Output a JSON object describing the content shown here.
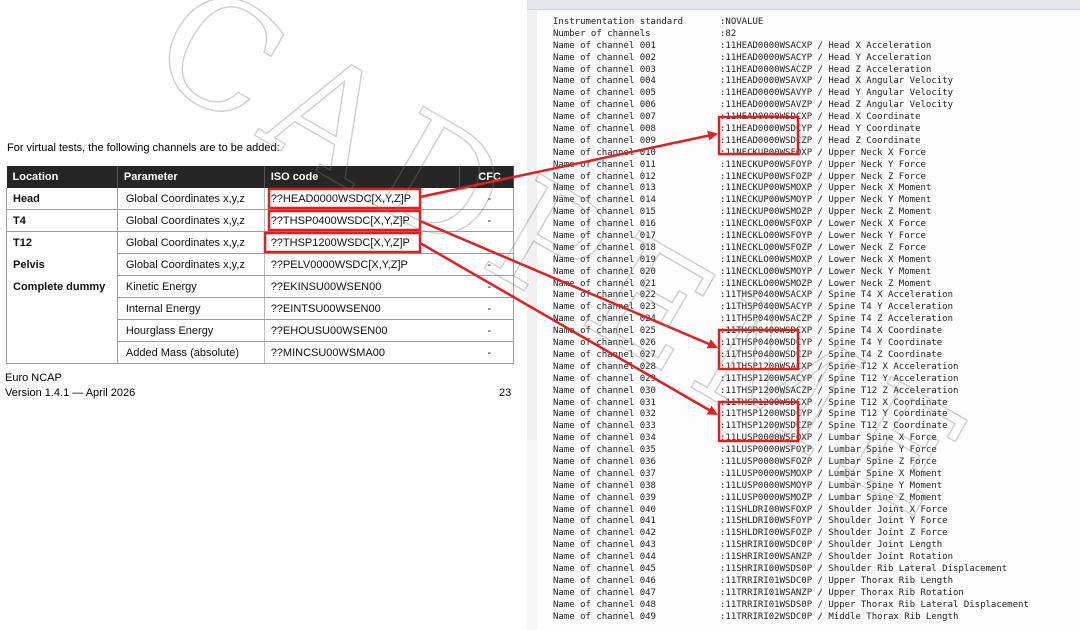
{
  "document": {
    "intro": "For virtual tests, the following channels are to be added:",
    "table": {
      "headers": [
        "Location",
        "Parameter",
        "ISO code",
        "CFC"
      ],
      "rows": [
        {
          "location": "Head",
          "parameter": "Global Coordinates x,y,z",
          "iso": "??HEAD0000WSDC[X,Y,Z]P",
          "cfc": "-"
        },
        {
          "location": "T4",
          "parameter": "Global Coordinates x,y,z",
          "iso": "??THSP0400WSDC[X,Y,Z]P",
          "cfc": "-"
        },
        {
          "location": "T12",
          "parameter": "Global Coordinates x,y,z",
          "iso": "??THSP1200WSDC[X,Y,Z]P",
          "cfc": ""
        },
        {
          "location": "Pelvis",
          "parameter": "Global Coordinates x,y,z",
          "iso": "??PELV0000WSDC[X,Y,Z]P",
          "cfc": "-"
        },
        {
          "location": "Complete dummy",
          "parameter": "Kinetic Energy",
          "iso": "??EKINSU00WSEN00",
          "cfc": "-"
        },
        {
          "location": "",
          "parameter": "Internal Energy",
          "iso": "??EINTSU00WSEN00",
          "cfc": "-"
        },
        {
          "location": "",
          "parameter": "Hourglass Energy",
          "iso": "??EHOUSU00WSEN00",
          "cfc": "-"
        },
        {
          "location": "",
          "parameter": "Added Mass (absolute)",
          "iso": "??MINCSU00WSMA00",
          "cfc": "-"
        }
      ]
    },
    "footer_org": "Euro NCAP",
    "footer_version": "Version 1.4.1 — April 2026",
    "page_number": "23"
  },
  "code_panel": {
    "lines": [
      {
        "label": "Instrumentation standard",
        "value": ":NOVALUE"
      },
      {
        "label": "Number of channels",
        "value": ":82"
      },
      {
        "label": "Name of channel 001",
        "value": ":11HEAD0000WSACXP / Head X Acceleration"
      },
      {
        "label": "Name of channel 002",
        "value": ":11HEAD0000WSACYP / Head Y Acceleration"
      },
      {
        "label": "Name of channel 003",
        "value": ":11HEAD0000WSACZP / Head Z Acceleration"
      },
      {
        "label": "Name of channel 004",
        "value": ":11HEAD0000WSAVXP / Head X Angular Velocity"
      },
      {
        "label": "Name of channel 005",
        "value": ":11HEAD0000WSAVYP / Head Y Angular Velocity"
      },
      {
        "label": "Name of channel 006",
        "value": ":11HEAD0000WSAVZP / Head Z Angular Velocity"
      },
      {
        "label": "Name of channel 007",
        "value": ":11HEAD0000WSDCXP / Head X Coordinate"
      },
      {
        "label": "Name of channel 008",
        "value": ":11HEAD0000WSDCYP / Head Y Coordinate"
      },
      {
        "label": "Name of channel 009",
        "value": ":11HEAD0000WSDCZP / Head Z Coordinate"
      },
      {
        "label": "Name of channel 010",
        "value": ":11NECKUP00WSFOXP / Upper Neck X Force"
      },
      {
        "label": "Name of channel 011",
        "value": ":11NECKUP00WSFOYP / Upper Neck Y Force"
      },
      {
        "label": "Name of channel 012",
        "value": ":11NECKUP00WSFOZP / Upper Neck Z Force"
      },
      {
        "label": "Name of channel 013",
        "value": ":11NECKUP00WSMOXP / Upper Neck X Moment"
      },
      {
        "label": "Name of channel 014",
        "value": ":11NECKUP00WSMOYP / Upper Neck Y Moment"
      },
      {
        "label": "Name of channel 015",
        "value": ":11NECKUP00WSMOZP / Upper Neck Z Moment"
      },
      {
        "label": "Name of channel 016",
        "value": ":11NECKLO00WSFOXP / Lower Neck X Force"
      },
      {
        "label": "Name of channel 017",
        "value": ":11NECKLO00WSFOYP / Lower Neck Y Force"
      },
      {
        "label": "Name of channel 018",
        "value": ":11NECKLO00WSFOZP / Lower Neck Z Force"
      },
      {
        "label": "Name of channel 019",
        "value": ":11NECKLO00WSMOXP / Lower Neck X Moment"
      },
      {
        "label": "Name of channel 020",
        "value": ":11NECKLO00WSMOYP / Lower Neck Y Moment"
      },
      {
        "label": "Name of channel 021",
        "value": ":11NECKLO00WSMOZP / Lower Neck Z Moment"
      },
      {
        "label": "Name of channel 022",
        "value": ":11THSP0400WSACXP / Spine T4 X Acceleration"
      },
      {
        "label": "Name of channel 023",
        "value": ":11THSP0400WSACYP / Spine T4 Y Acceleration"
      },
      {
        "label": "Name of channel 024",
        "value": ":11THSP0400WSACZP / Spine T4 Z Acceleration"
      },
      {
        "label": "Name of channel 025",
        "value": ":11THSP0400WSDCXP / Spine T4 X Coordinate"
      },
      {
        "label": "Name of channel 026",
        "value": ":11THSP0400WSDCYP / Spine T4 Y Coordinate"
      },
      {
        "label": "Name of channel 027",
        "value": ":11THSP0400WSDCZP / Spine T4 Z Coordinate"
      },
      {
        "label": "Name of channel 028",
        "value": ":11THSP1200WSACXP / Spine T12 X Acceleration"
      },
      {
        "label": "Name of channel 029",
        "value": ":11THSP1200WSACYP / Spine T12 Y Acceleration"
      },
      {
        "label": "Name of channel 030",
        "value": ":11THSP1200WSACZP / Spine T12 Z Acceleration"
      },
      {
        "label": "Name of channel 031",
        "value": ":11THSP1200WSDCXP / Spine T12 X Coordinate"
      },
      {
        "label": "Name of channel 032",
        "value": ":11THSP1200WSDCYP / Spine T12 Y Coordinate"
      },
      {
        "label": "Name of channel 033",
        "value": ":11THSP1200WSDCZP / Spine T12 Z Coordinate"
      },
      {
        "label": "Name of channel 034",
        "value": ":11LUSP0000WSFOXP / Lumbar Spine X Force"
      },
      {
        "label": "Name of channel 035",
        "value": ":11LUSP0000WSFOYP / Lumbar Spine Y Force"
      },
      {
        "label": "Name of channel 036",
        "value": ":11LUSP0000WSFOZP / Lumbar Spine Z Force"
      },
      {
        "label": "Name of channel 037",
        "value": ":11LUSP0000WSMOXP / Lumbar Spine X Moment"
      },
      {
        "label": "Name of channel 038",
        "value": ":11LUSP0000WSMOYP / Lumbar Spine Y Moment"
      },
      {
        "label": "Name of channel 039",
        "value": ":11LUSP0000WSMOZP / Lumbar Spine Z Moment"
      },
      {
        "label": "Name of channel 040",
        "value": ":11SHLDRI00WSFOXP / Shoulder Joint X Force"
      },
      {
        "label": "Name of channel 041",
        "value": ":11SHLDRI00WSFOYP / Shoulder Joint Y Force"
      },
      {
        "label": "Name of channel 042",
        "value": ":11SHLDRI00WSFOZP / Shoulder Joint Z Force"
      },
      {
        "label": "Name of channel 043",
        "value": ":11SHRIRI00WSDC0P / Shoulder Joint Length"
      },
      {
        "label": "Name of channel 044",
        "value": ":11SHRIRI00WSANZP / Shoulder Joint Rotation"
      },
      {
        "label": "Name of channel 045",
        "value": ":11SHRIRI00WSDS0P / Shoulder Rib Lateral Displacement"
      },
      {
        "label": "Name of channel 046",
        "value": ":11TRRIRI01WSDC0P / Upper Thorax Rib Length"
      },
      {
        "label": "Name of channel 047",
        "value": ":11TRRIRI01WSANZP / Upper Thorax Rib Rotation"
      },
      {
        "label": "Name of channel 048",
        "value": ":11TRRIRI01WSDS0P / Upper Thorax Rib Lateral Displacement"
      },
      {
        "label": "Name of channel 049",
        "value": ":11TRRIRI02WSDC0P / Middle Thorax Rib Length"
      }
    ]
  },
  "watermark": "CADPEME",
  "colors": {
    "highlight": "#e02020",
    "header_bg": "#262626",
    "panel_bg": "#fdfdfd"
  }
}
